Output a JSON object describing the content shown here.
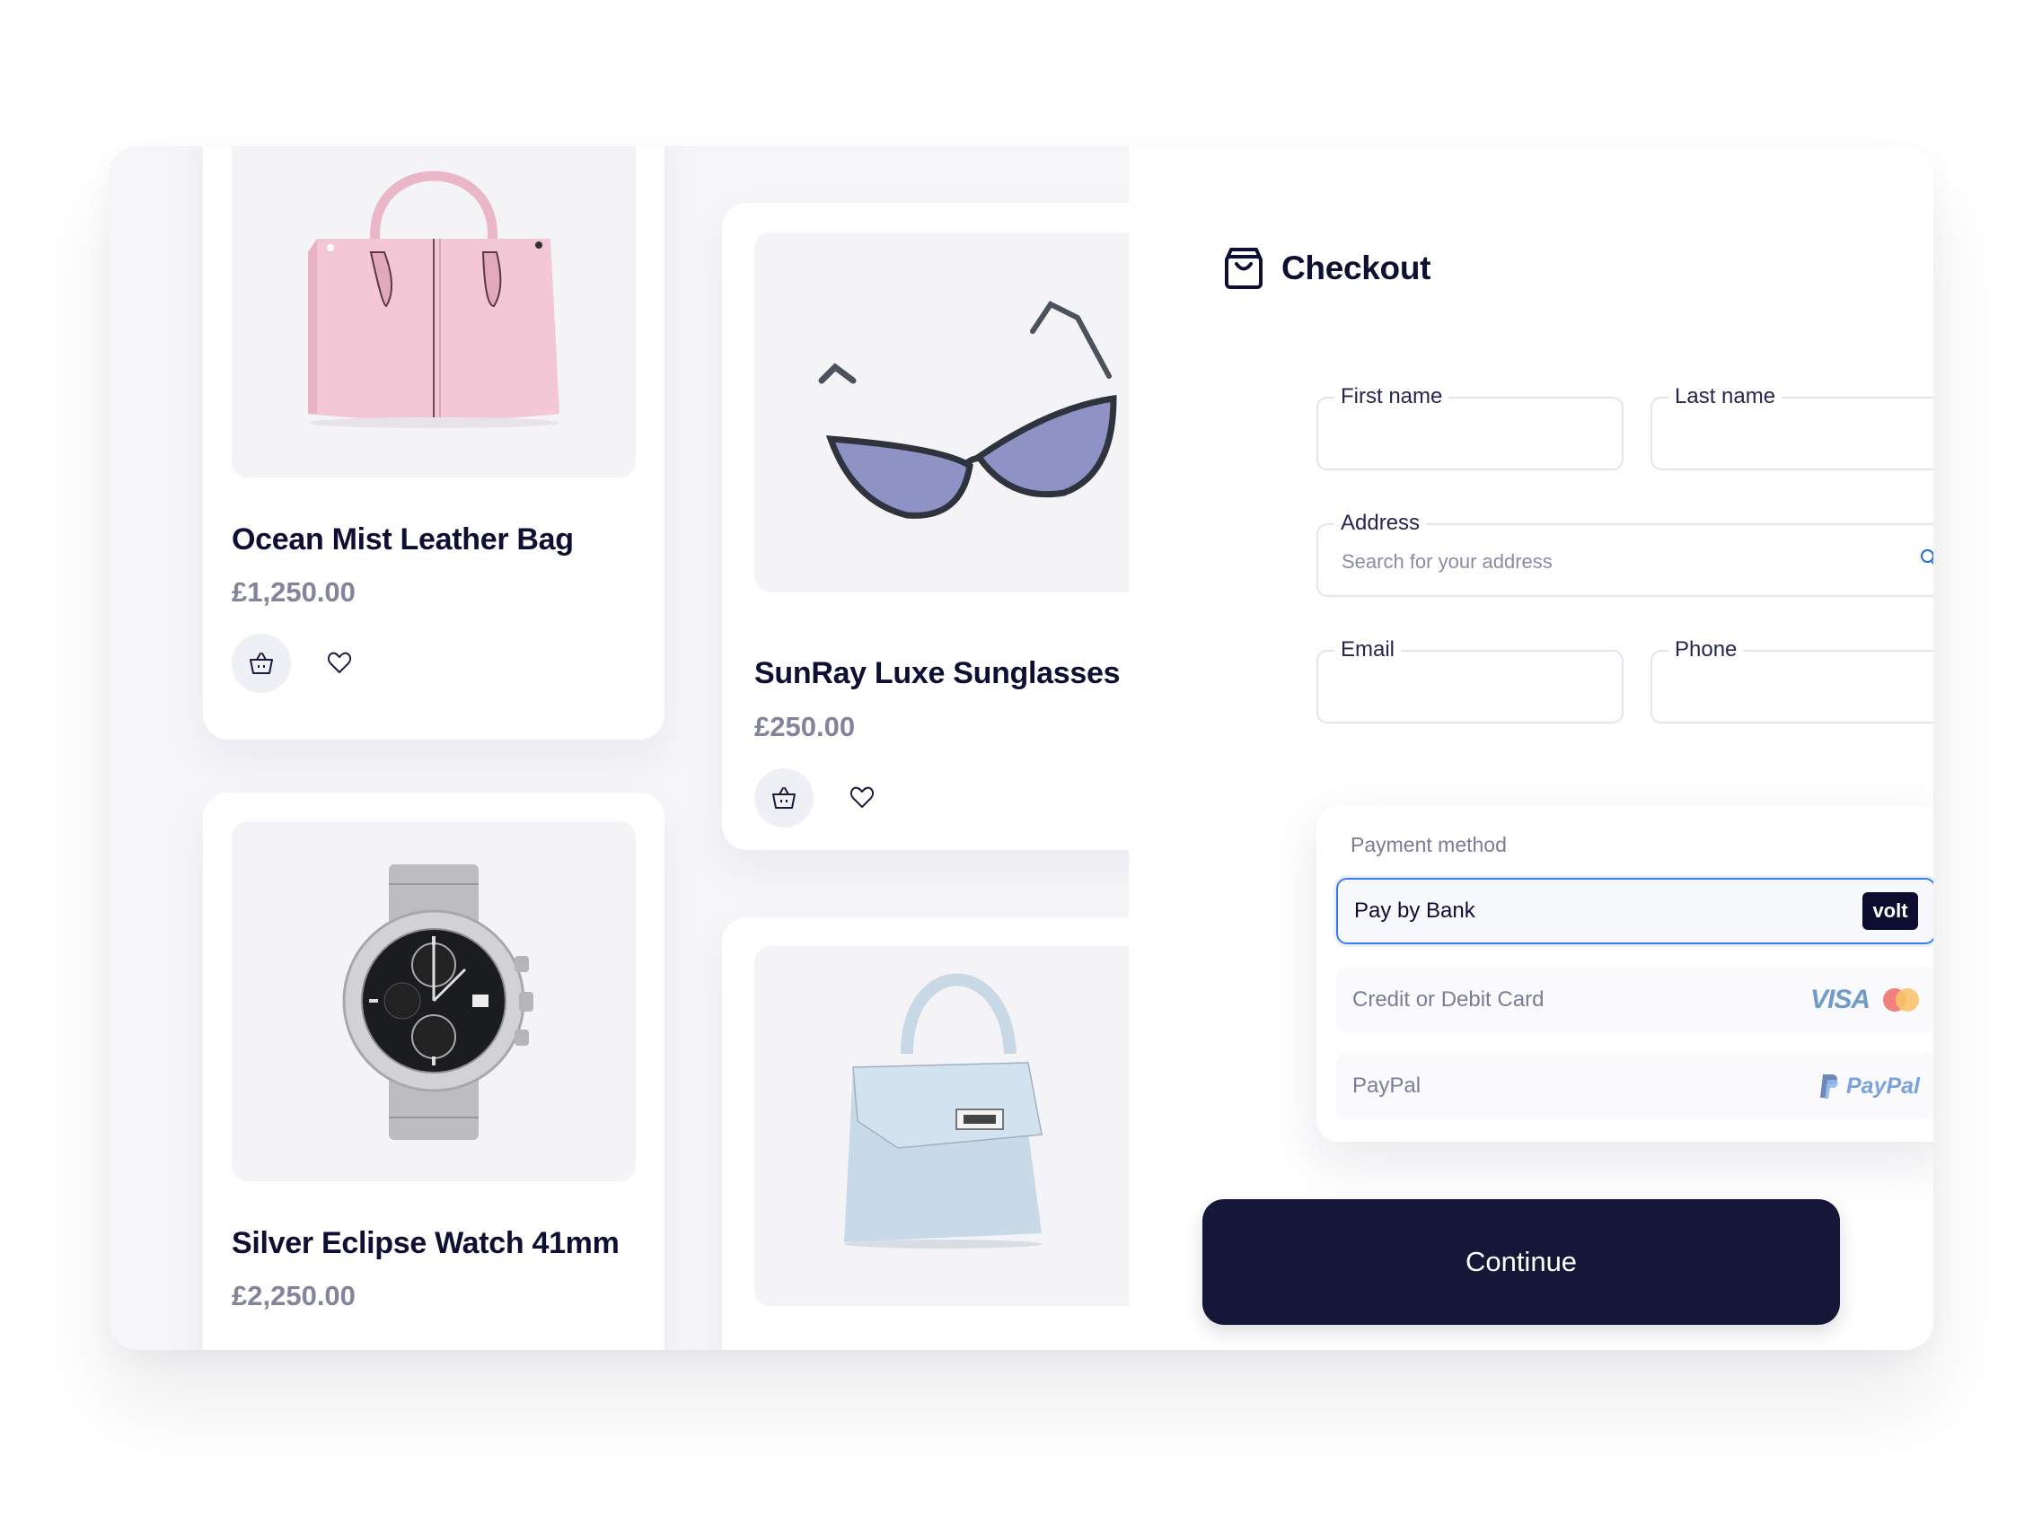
{
  "products": [
    {
      "name": "Ocean Mist Leather Bag",
      "price": "£1,250.00",
      "image": "pink-handbag"
    },
    {
      "name": "SunRay Luxe Sunglasses",
      "price": "£250.00",
      "image": "sunglasses"
    },
    {
      "name": "Silver Eclipse Watch 41mm",
      "price": "£2,250.00",
      "image": "chronograph-watch"
    },
    {
      "name": "",
      "price": "",
      "image": "light-blue-handbag"
    }
  ],
  "checkout": {
    "title": "Checkout",
    "icon": "shopping-bag-icon",
    "fields": {
      "first_name": {
        "label": "First name",
        "value": ""
      },
      "last_name": {
        "label": "Last name",
        "value": ""
      },
      "address": {
        "label": "Address",
        "placeholder": "Search for your address"
      },
      "email": {
        "label": "Email",
        "value": ""
      },
      "phone": {
        "label": "Phone",
        "value": ""
      }
    },
    "payment": {
      "label": "Payment method",
      "options": [
        {
          "label": "Pay by Bank",
          "logo": "volt",
          "selected": true
        },
        {
          "label": "Credit or Debit Card",
          "logo": "VISA",
          "selected": false
        },
        {
          "label": "PayPal",
          "logo": "PayPal",
          "selected": false
        }
      ]
    },
    "continue_label": "Continue"
  },
  "colors": {
    "primary": "#141737",
    "accent": "#3a7bf2",
    "price": "#82849c"
  }
}
